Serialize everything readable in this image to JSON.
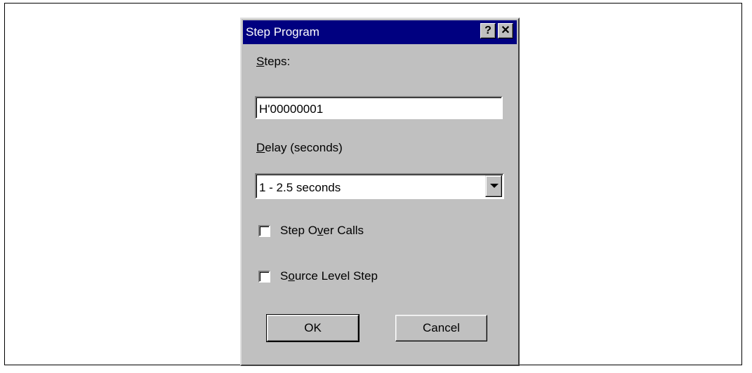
{
  "dialog": {
    "title": "Step Program",
    "help_glyph": "?",
    "close_glyph": "✕",
    "steps_label_accel": "S",
    "steps_label_rest": "teps:",
    "steps_value": "H'00000001",
    "delay_label_accel": "D",
    "delay_label_rest": "elay (seconds)",
    "delay_selected": "1 - 2.5 seconds",
    "step_over_pre": "Step O",
    "step_over_accel": "v",
    "step_over_post": "er Calls",
    "step_over_checked": false,
    "source_level_pre": "S",
    "source_level_accel": "o",
    "source_level_post": "urce Level Step",
    "source_level_checked": false,
    "ok_label": "OK",
    "cancel_label": "Cancel"
  },
  "icons": [
    "help-icon",
    "close-icon",
    "dropdown-arrow-icon"
  ],
  "colors": {
    "titlebar": "#000080",
    "face": "#c0c0c0"
  }
}
